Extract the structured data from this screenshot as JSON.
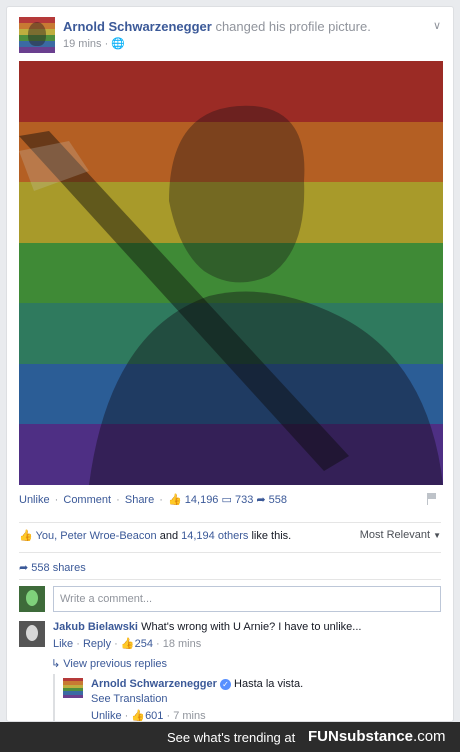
{
  "post": {
    "author": "Arnold Schwarzenegger",
    "action": "changed his profile picture.",
    "time": "19 mins",
    "privacy_glyph": "🌐",
    "menu_glyph": "∨",
    "flag_colors": [
      "#e53935",
      "#f57c00",
      "#fbc02d",
      "#43a047",
      "#1e88e5",
      "#5e35b1"
    ]
  },
  "actions": {
    "unlike": "Unlike",
    "comment": "Comment",
    "share": "Share",
    "like_count": "14,196",
    "comment_count": "733",
    "share_count": "558"
  },
  "likes": {
    "text_blue1": "You,",
    "text_blue2": "Peter Wroe-Beacon",
    "and": "and",
    "text_blue3": "14,194 others",
    "suffix": "like this.",
    "sort_label": "Most Relevant"
  },
  "shares": {
    "text": "558 shares"
  },
  "comment_box": {
    "placeholder": "Write a comment..."
  },
  "comments": [
    {
      "author": "Jakub Bielawski",
      "text": "What's wrong with U Arnie? I have to unlike...",
      "like": "Like",
      "reply": "Reply",
      "likes": "254",
      "time": "18 mins"
    }
  ],
  "view_previous": "View previous replies",
  "reply": {
    "author": "Arnold Schwarzenegger",
    "text": "Hasta la vista.",
    "see_translation": "See Translation",
    "unlike": "Unlike",
    "likes": "601",
    "time": "7 mins"
  },
  "footer": {
    "trending": "See what's trending at",
    "brand_fun": "FUN",
    "brand_sub": "substance",
    "brand_com": ".com"
  }
}
